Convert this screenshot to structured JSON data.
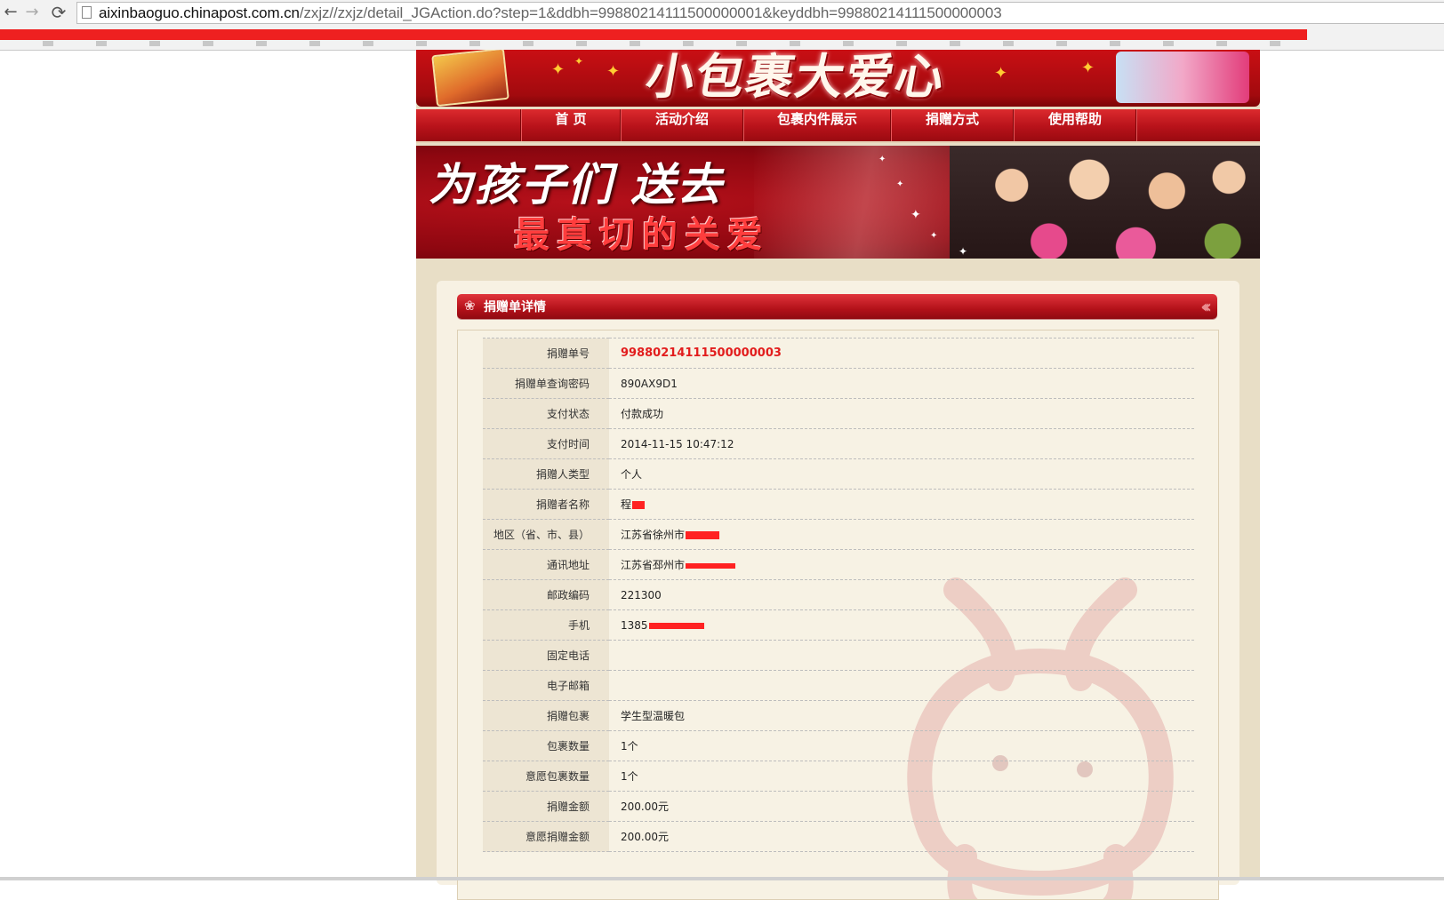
{
  "browser": {
    "url_host": "aixinbaoguo.chinapost.com.cn",
    "url_path": "/zxjz//zxjz/detail_JGAction.do?step=1&ddbh=99880214111500000001&keyddbh=99880214111500000003",
    "back_icon": "arrow-left-icon",
    "forward_icon": "arrow-right-icon",
    "reload_icon": "reload-icon",
    "glyphs": {
      "back": "←",
      "forward": "→",
      "reload": "⟳"
    }
  },
  "site": {
    "nav": [
      "首 页",
      "活动介绍",
      "包裹内件展示",
      "捐赠方式",
      "使用帮助"
    ],
    "promo_line1": "为孩子们 送去",
    "promo_line2": "最真切的关爱",
    "banner_title": "小包裹大爱心"
  },
  "section": {
    "title": "捐赠单详情",
    "icon": "swirl-icon",
    "icon_glyph": "❀",
    "arrows_glyph": "‹‹‹"
  },
  "details": {
    "rows": [
      {
        "label": "捐赠单号",
        "value": "99880214111500000003",
        "highlight": true
      },
      {
        "label": "捐赠单查询密码",
        "value": "890AX9D1"
      },
      {
        "label": "支付状态",
        "value": "付款成功"
      },
      {
        "label": "支付时间",
        "value": "2014-11-15 10:47:12"
      },
      {
        "label": "捐赠人类型",
        "value": "个人"
      },
      {
        "label": "捐赠者名称",
        "value": "程",
        "redacted": true
      },
      {
        "label": "地区（省、市、县）",
        "value": "江苏省徐州市",
        "redacted": true
      },
      {
        "label": "通讯地址",
        "value": "江苏省邳州市",
        "redacted": true
      },
      {
        "label": "邮政编码",
        "value": "221300"
      },
      {
        "label": "手机",
        "value": "1385",
        "redacted": true
      },
      {
        "label": "固定电话",
        "value": ""
      },
      {
        "label": "电子邮箱",
        "value": ""
      },
      {
        "label": "捐赠包裹",
        "value": "学生型温暖包"
      },
      {
        "label": "包裹数量",
        "value": "1个"
      },
      {
        "label": "意愿包裹数量",
        "value": "1个"
      },
      {
        "label": "捐赠金额",
        "value": "200.00元"
      },
      {
        "label": "意愿捐赠金额",
        "value": "200.00元"
      }
    ]
  },
  "colors": {
    "accent_red": "#c90f14",
    "highlight_text": "#e21d1d",
    "label_bg": "#ede5d3",
    "panel_bg": "#f7f1e3"
  }
}
